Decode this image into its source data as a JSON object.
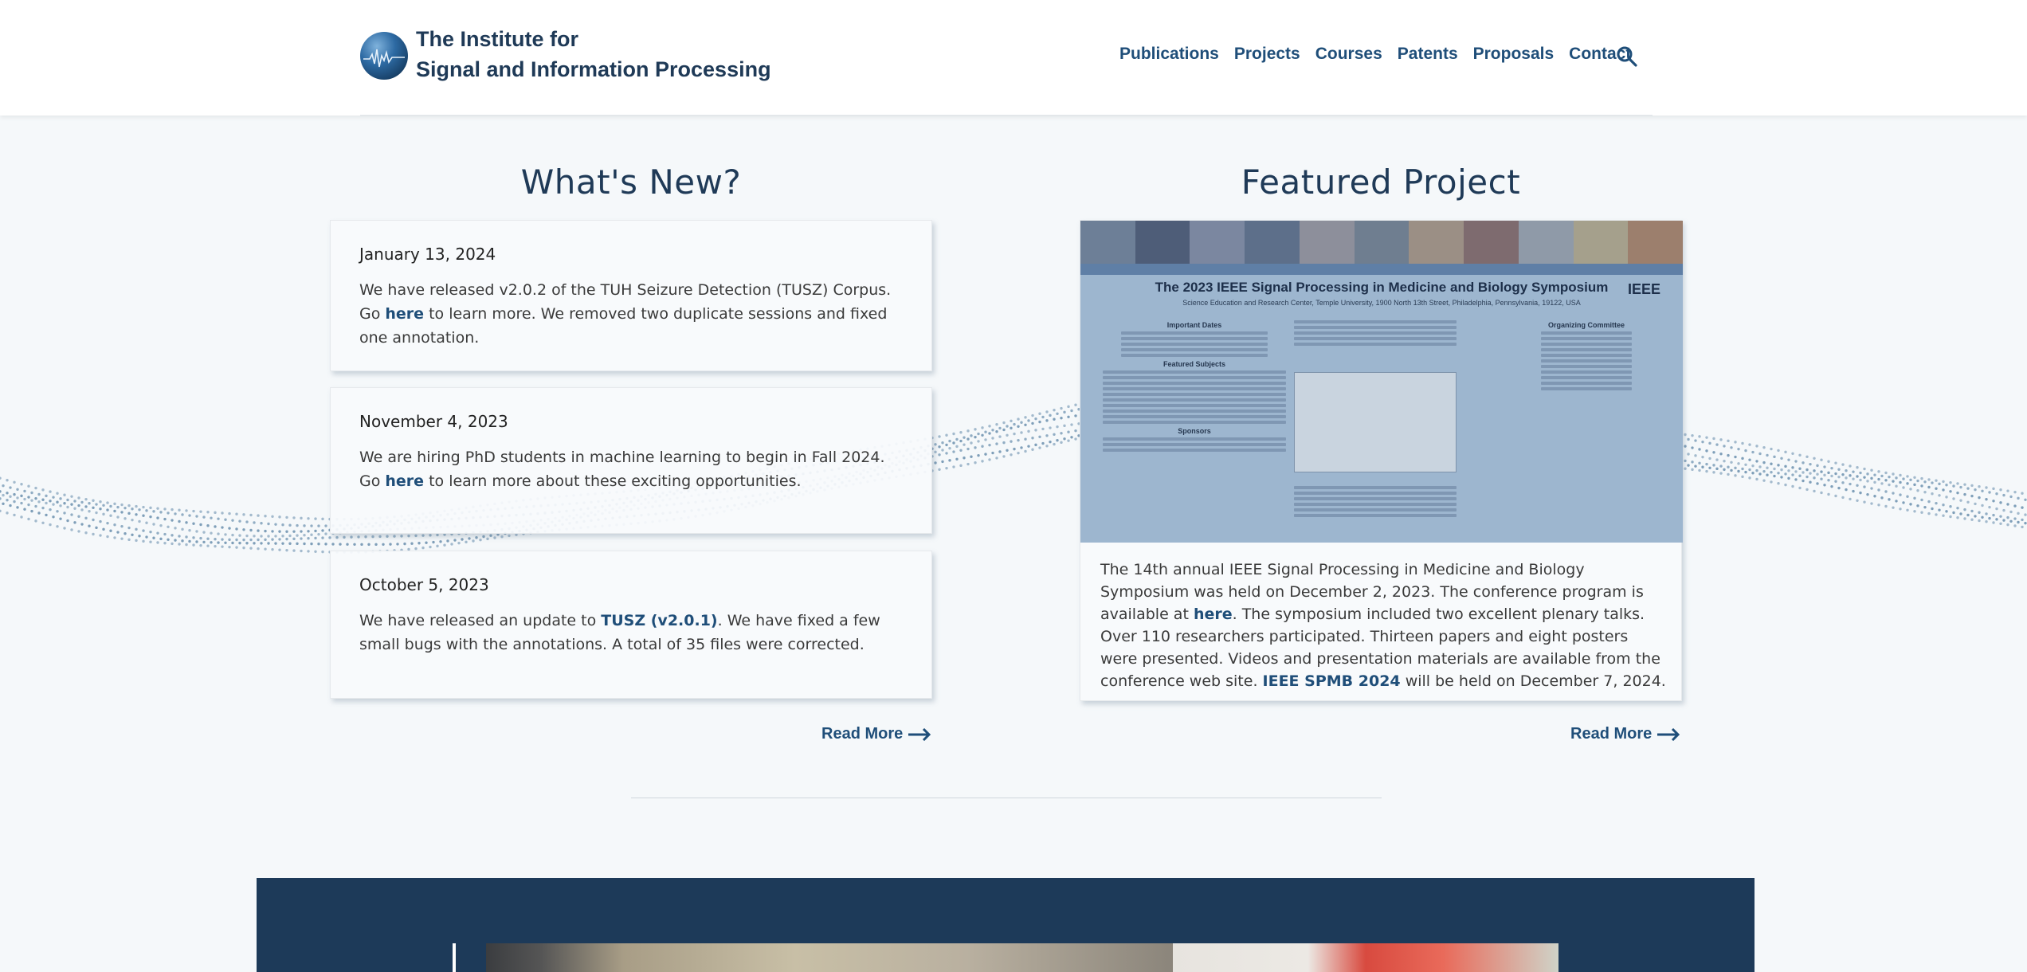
{
  "header": {
    "brand_line1": "The Institute for",
    "brand_line2": "Signal and Information Processing",
    "nav": [
      "Publications",
      "Projects",
      "Courses",
      "Patents",
      "Proposals",
      "Contact"
    ],
    "search_icon": "search-icon"
  },
  "whats_new": {
    "title": "What's New?",
    "items": [
      {
        "date": "January 13, 2024",
        "t1": "We have released v2.0.2 of the TUH Seizure Detection (TUSZ) Corpus. Go ",
        "link": "here",
        "t2": " to learn more. We removed two duplicate sessions and fixed one annotation."
      },
      {
        "date": "November 4, 2023",
        "t1": "We are hiring PhD students in machine learning to begin in Fall 2024. Go ",
        "link": "here",
        "t2": " to learn more about these exciting opportunities."
      },
      {
        "date": "October 5, 2023",
        "t1": "We have released an update to ",
        "link": "TUSZ (v2.0.1)",
        "t2": ". We have fixed a few small bugs with the annotations. A total of 35 files were corrected."
      }
    ],
    "read_more": "Read More"
  },
  "featured": {
    "title": "Featured Project",
    "poster_title": "The 2023 IEEE Signal Processing in Medicine and Biology Symposium",
    "poster_sub": "Science Education and Research Center, Temple University, 1900 North 13th Street, Philadelphia, Pennsylvania, 19122, USA",
    "poster_logo": "IEEE",
    "poster_headings": [
      "Important Dates",
      "Featured Subjects",
      "Sponsors",
      "Organizing Committee"
    ],
    "desc_1": "The 14th annual IEEE Signal Processing in Medicine and Biology Symposium was held on December 2, 2023. The conference program is available at ",
    "desc_link1": "here",
    "desc_2": ". The symposium included two excellent plenary talks. Over 110 researchers participated. Thirteen papers and eight posters were presented. Videos and presentation materials are available from the conference web site. ",
    "desc_link2": "IEEE SPMB 2024",
    "desc_3": " will be held on December 7, 2024.",
    "read_more": "Read More"
  },
  "colors": {
    "brand": "#1f3a57",
    "link": "#1f4e79",
    "band": "#1d3a59",
    "background": "#f5f8fa"
  }
}
